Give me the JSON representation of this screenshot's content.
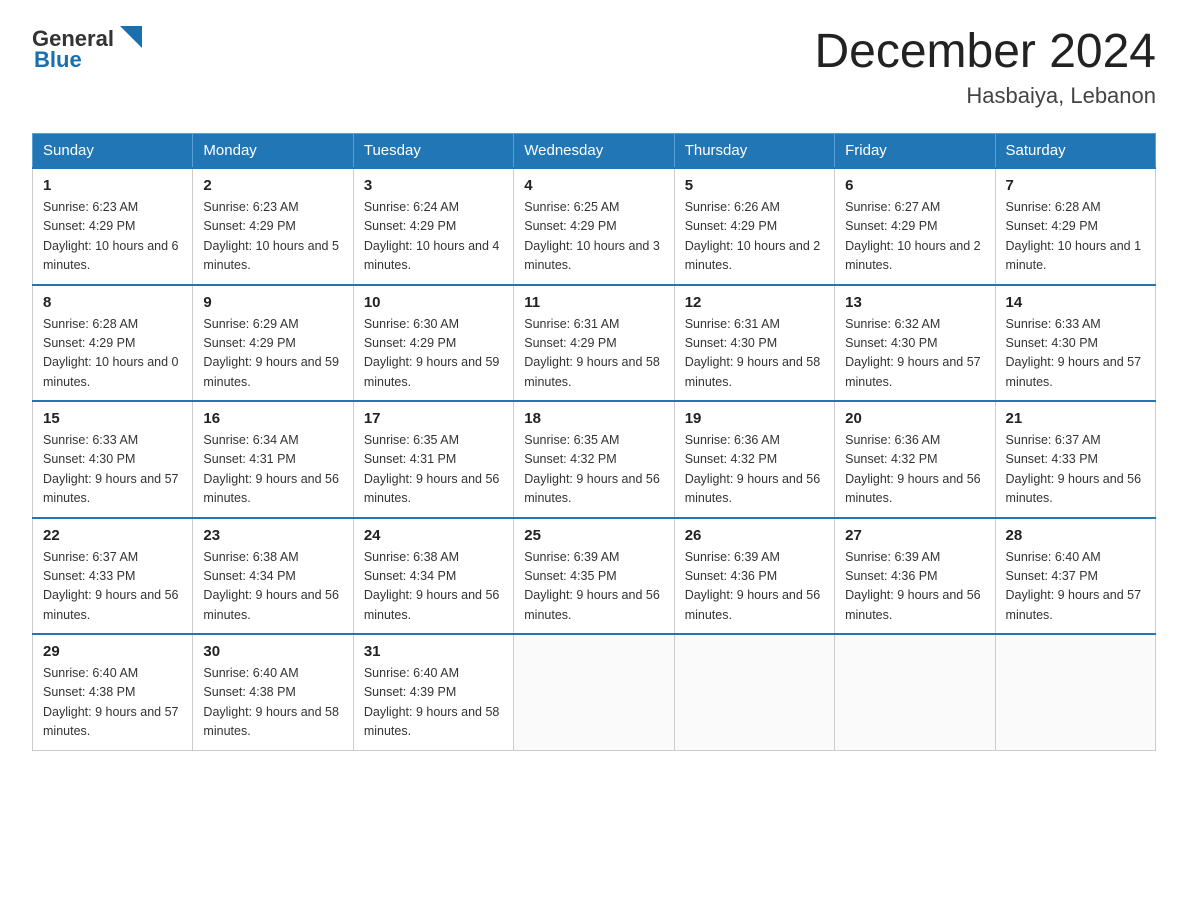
{
  "header": {
    "logo_general": "General",
    "logo_blue": "Blue",
    "month_title": "December 2024",
    "location": "Hasbaiya, Lebanon"
  },
  "columns": [
    "Sunday",
    "Monday",
    "Tuesday",
    "Wednesday",
    "Thursday",
    "Friday",
    "Saturday"
  ],
  "weeks": [
    [
      {
        "day": "1",
        "sunrise": "6:23 AM",
        "sunset": "4:29 PM",
        "daylight": "10 hours and 6 minutes."
      },
      {
        "day": "2",
        "sunrise": "6:23 AM",
        "sunset": "4:29 PM",
        "daylight": "10 hours and 5 minutes."
      },
      {
        "day": "3",
        "sunrise": "6:24 AM",
        "sunset": "4:29 PM",
        "daylight": "10 hours and 4 minutes."
      },
      {
        "day": "4",
        "sunrise": "6:25 AM",
        "sunset": "4:29 PM",
        "daylight": "10 hours and 3 minutes."
      },
      {
        "day": "5",
        "sunrise": "6:26 AM",
        "sunset": "4:29 PM",
        "daylight": "10 hours and 2 minutes."
      },
      {
        "day": "6",
        "sunrise": "6:27 AM",
        "sunset": "4:29 PM",
        "daylight": "10 hours and 2 minutes."
      },
      {
        "day": "7",
        "sunrise": "6:28 AM",
        "sunset": "4:29 PM",
        "daylight": "10 hours and 1 minute."
      }
    ],
    [
      {
        "day": "8",
        "sunrise": "6:28 AM",
        "sunset": "4:29 PM",
        "daylight": "10 hours and 0 minutes."
      },
      {
        "day": "9",
        "sunrise": "6:29 AM",
        "sunset": "4:29 PM",
        "daylight": "9 hours and 59 minutes."
      },
      {
        "day": "10",
        "sunrise": "6:30 AM",
        "sunset": "4:29 PM",
        "daylight": "9 hours and 59 minutes."
      },
      {
        "day": "11",
        "sunrise": "6:31 AM",
        "sunset": "4:29 PM",
        "daylight": "9 hours and 58 minutes."
      },
      {
        "day": "12",
        "sunrise": "6:31 AM",
        "sunset": "4:30 PM",
        "daylight": "9 hours and 58 minutes."
      },
      {
        "day": "13",
        "sunrise": "6:32 AM",
        "sunset": "4:30 PM",
        "daylight": "9 hours and 57 minutes."
      },
      {
        "day": "14",
        "sunrise": "6:33 AM",
        "sunset": "4:30 PM",
        "daylight": "9 hours and 57 minutes."
      }
    ],
    [
      {
        "day": "15",
        "sunrise": "6:33 AM",
        "sunset": "4:30 PM",
        "daylight": "9 hours and 57 minutes."
      },
      {
        "day": "16",
        "sunrise": "6:34 AM",
        "sunset": "4:31 PM",
        "daylight": "9 hours and 56 minutes."
      },
      {
        "day": "17",
        "sunrise": "6:35 AM",
        "sunset": "4:31 PM",
        "daylight": "9 hours and 56 minutes."
      },
      {
        "day": "18",
        "sunrise": "6:35 AM",
        "sunset": "4:32 PM",
        "daylight": "9 hours and 56 minutes."
      },
      {
        "day": "19",
        "sunrise": "6:36 AM",
        "sunset": "4:32 PM",
        "daylight": "9 hours and 56 minutes."
      },
      {
        "day": "20",
        "sunrise": "6:36 AM",
        "sunset": "4:32 PM",
        "daylight": "9 hours and 56 minutes."
      },
      {
        "day": "21",
        "sunrise": "6:37 AM",
        "sunset": "4:33 PM",
        "daylight": "9 hours and 56 minutes."
      }
    ],
    [
      {
        "day": "22",
        "sunrise": "6:37 AM",
        "sunset": "4:33 PM",
        "daylight": "9 hours and 56 minutes."
      },
      {
        "day": "23",
        "sunrise": "6:38 AM",
        "sunset": "4:34 PM",
        "daylight": "9 hours and 56 minutes."
      },
      {
        "day": "24",
        "sunrise": "6:38 AM",
        "sunset": "4:34 PM",
        "daylight": "9 hours and 56 minutes."
      },
      {
        "day": "25",
        "sunrise": "6:39 AM",
        "sunset": "4:35 PM",
        "daylight": "9 hours and 56 minutes."
      },
      {
        "day": "26",
        "sunrise": "6:39 AM",
        "sunset": "4:36 PM",
        "daylight": "9 hours and 56 minutes."
      },
      {
        "day": "27",
        "sunrise": "6:39 AM",
        "sunset": "4:36 PM",
        "daylight": "9 hours and 56 minutes."
      },
      {
        "day": "28",
        "sunrise": "6:40 AM",
        "sunset": "4:37 PM",
        "daylight": "9 hours and 57 minutes."
      }
    ],
    [
      {
        "day": "29",
        "sunrise": "6:40 AM",
        "sunset": "4:38 PM",
        "daylight": "9 hours and 57 minutes."
      },
      {
        "day": "30",
        "sunrise": "6:40 AM",
        "sunset": "4:38 PM",
        "daylight": "9 hours and 58 minutes."
      },
      {
        "day": "31",
        "sunrise": "6:40 AM",
        "sunset": "4:39 PM",
        "daylight": "9 hours and 58 minutes."
      },
      null,
      null,
      null,
      null
    ]
  ]
}
